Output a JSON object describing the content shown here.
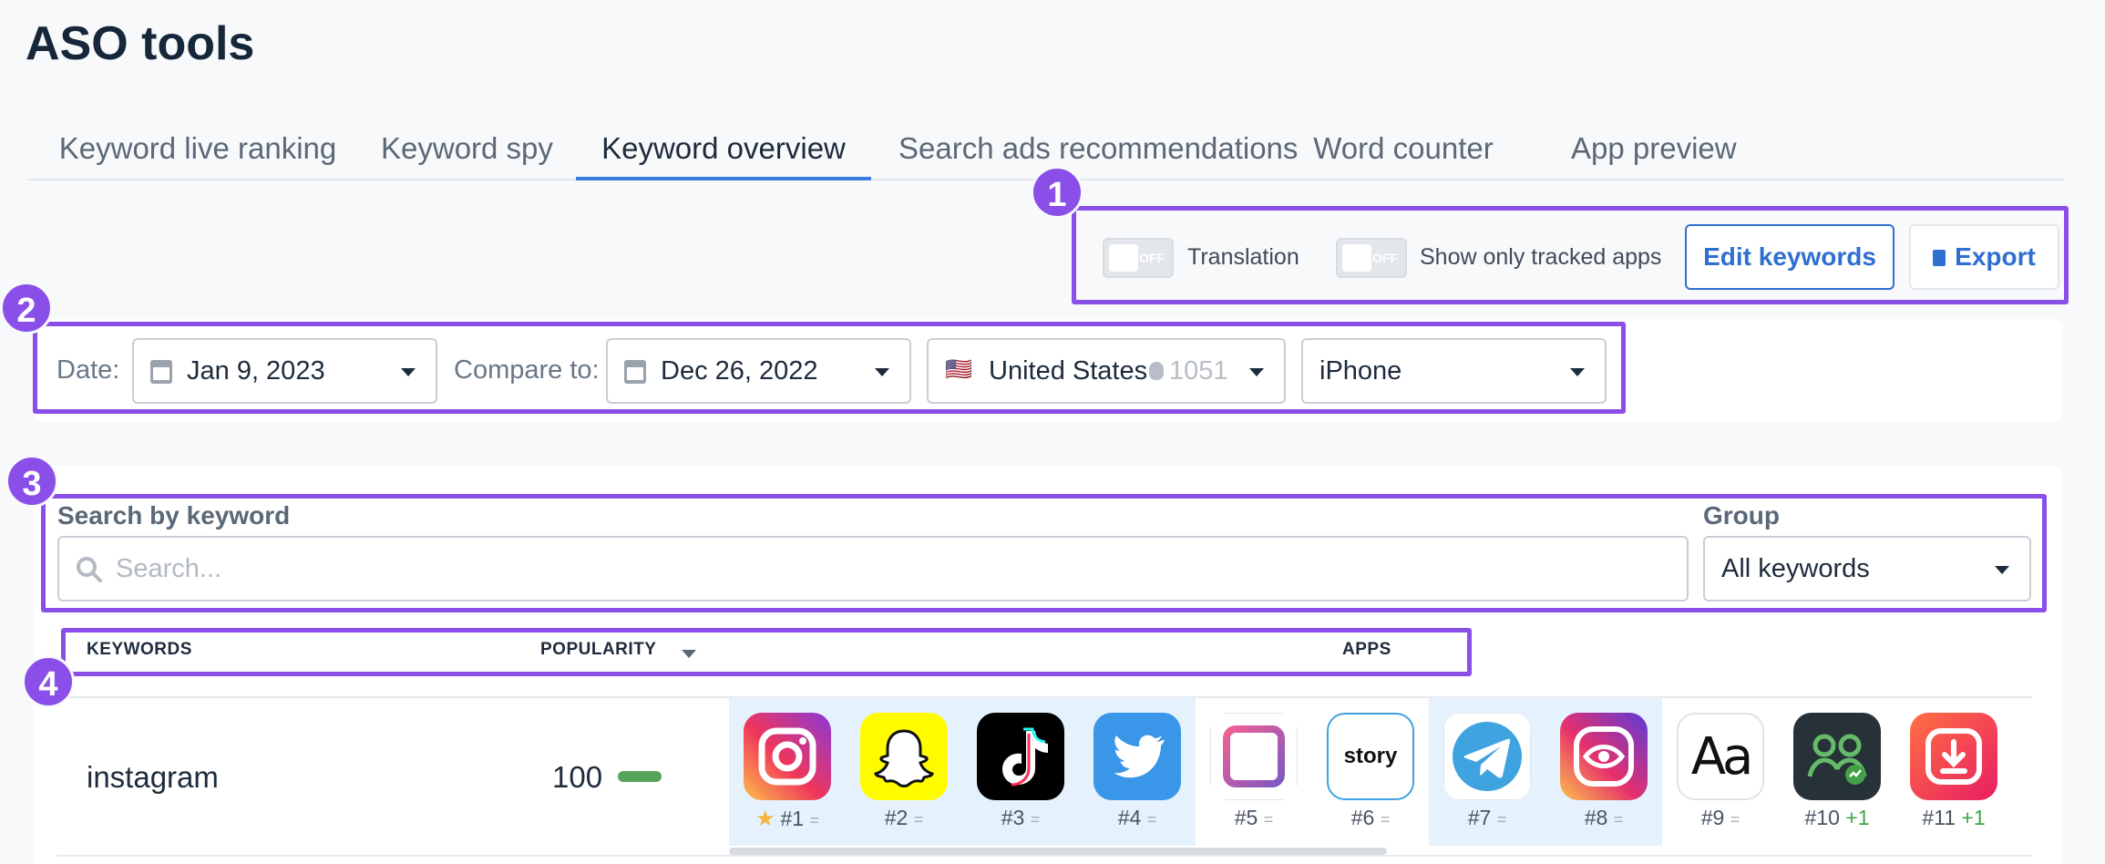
{
  "page": {
    "title": "ASO tools"
  },
  "tabs": [
    {
      "label": "Keyword live ranking"
    },
    {
      "label": "Keyword spy"
    },
    {
      "label": "Keyword overview"
    },
    {
      "label": "Search ads recommendations"
    },
    {
      "label": "Word counter"
    },
    {
      "label": "App preview"
    }
  ],
  "active_tab": "Keyword overview",
  "callouts": [
    "1",
    "2",
    "3",
    "4"
  ],
  "toolbar": {
    "translation_label": "Translation",
    "tracked_label": "Show only tracked apps",
    "toggle_state": "OFF",
    "edit_keywords": "Edit keywords",
    "export": "Export"
  },
  "filters": {
    "date_label": "Date:",
    "date_value": "Jan 9, 2023",
    "compare_label": "Compare to:",
    "compare_value": "Dec 26, 2022",
    "country_flag": "🇺🇸",
    "country": "United States",
    "country_count": "1051",
    "device": "iPhone"
  },
  "search": {
    "label": "Search by keyword",
    "placeholder": "Search...",
    "group_label": "Group",
    "group_value": "All keywords"
  },
  "table": {
    "col_keywords": "KEYWORDS",
    "col_popularity": "POPULARITY",
    "col_apps": "APPS",
    "rows": [
      {
        "keyword": "instagram",
        "popularity": "100",
        "popularity_level": 1.0,
        "apps": [
          {
            "icon": "instagram-icon",
            "rank": "#1",
            "change": "=",
            "starred": true,
            "highlighted": true
          },
          {
            "icon": "snapchat-icon",
            "rank": "#2",
            "change": "=",
            "highlighted": true
          },
          {
            "icon": "tiktok-icon",
            "rank": "#3",
            "change": "=",
            "highlighted": true
          },
          {
            "icon": "twitter-icon",
            "rank": "#4",
            "change": "=",
            "highlighted": true
          },
          {
            "icon": "layout-icon",
            "rank": "#5",
            "change": "="
          },
          {
            "icon": "story-icon",
            "icon_text": "story",
            "rank": "#6",
            "change": "="
          },
          {
            "icon": "telegram-icon",
            "rank": "#7",
            "change": "=",
            "highlighted": true
          },
          {
            "icon": "insta-eye-icon",
            "rank": "#8",
            "change": "=",
            "highlighted": true
          },
          {
            "icon": "fonts-icon",
            "icon_text": "Aa",
            "rank": "#9",
            "change": "="
          },
          {
            "icon": "followers-icon",
            "rank": "#10",
            "change": "+1"
          },
          {
            "icon": "downloader-icon",
            "rank": "#11",
            "change": "+1"
          }
        ]
      }
    ]
  },
  "colors": {
    "accent": "#3a7be0",
    "callout": "#8a4fe8",
    "highlight": "#e5f1fc",
    "popularity_bar": "#55a457",
    "rank_up": "#3fa548"
  }
}
